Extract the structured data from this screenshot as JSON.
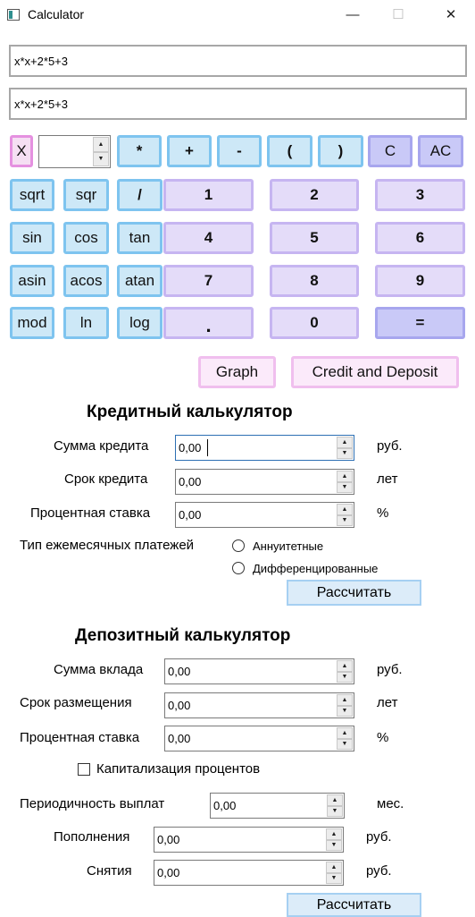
{
  "window": {
    "title": "Calculator",
    "minimize_glyph": "—",
    "maximize_glyph": "☐",
    "close_glyph": "✕"
  },
  "expression": {
    "input": "x*x+2*5+3",
    "display": "x*x+2*5+3"
  },
  "calc": {
    "x_button": "X",
    "x_value": "",
    "ops": [
      "*",
      "+",
      "-",
      "(",
      ")",
      "C",
      "AC"
    ],
    "funcs": [
      "sqrt",
      "sqr",
      "/",
      "sin",
      "cos",
      "tan",
      "asin",
      "acos",
      "atan",
      "mod",
      "ln",
      "log"
    ],
    "digits": [
      "1",
      "2",
      "3",
      "4",
      "5",
      "6",
      "7",
      "8",
      "9",
      ".",
      "0",
      "="
    ],
    "graph": "Graph",
    "credit_deposit": "Credit and Deposit"
  },
  "credit": {
    "heading": "Кредитный калькулятор",
    "amount_label": "Сумма кредита",
    "amount_value": "0,00",
    "amount_unit": "руб.",
    "term_label": "Срок кредита",
    "term_value": "0,00",
    "term_unit": "лет",
    "rate_label": "Процентная ставка",
    "rate_value": "0,00",
    "rate_unit": "%",
    "payment_type_label": "Тип ежемесячных платежей",
    "annuity": "Аннуитетные",
    "differentiated": "Дифференцированные",
    "calculate": "Рассчитать"
  },
  "deposit": {
    "heading": "Депозитный калькулятор",
    "amount_label": "Сумма вклада",
    "amount_value": "0,00",
    "amount_unit": "руб.",
    "term_label": "Срок размещения",
    "term_value": "0,00",
    "term_unit": "лет",
    "rate_label": "Процентная ставка",
    "rate_value": "0,00",
    "rate_unit": "%",
    "capitalization": "Капитализация процентов",
    "period_label": "Периодичность выплат",
    "period_value": "0,00",
    "period_unit": "мес.",
    "replenish_label": "Пополнения",
    "replenish_value": "0,00",
    "replenish_unit": "руб.",
    "withdraw_label": "Снятия",
    "withdraw_value": "0,00",
    "withdraw_unit": "руб.",
    "calculate": "Рассчитать"
  },
  "spin_up": "▲",
  "spin_down": "▼"
}
